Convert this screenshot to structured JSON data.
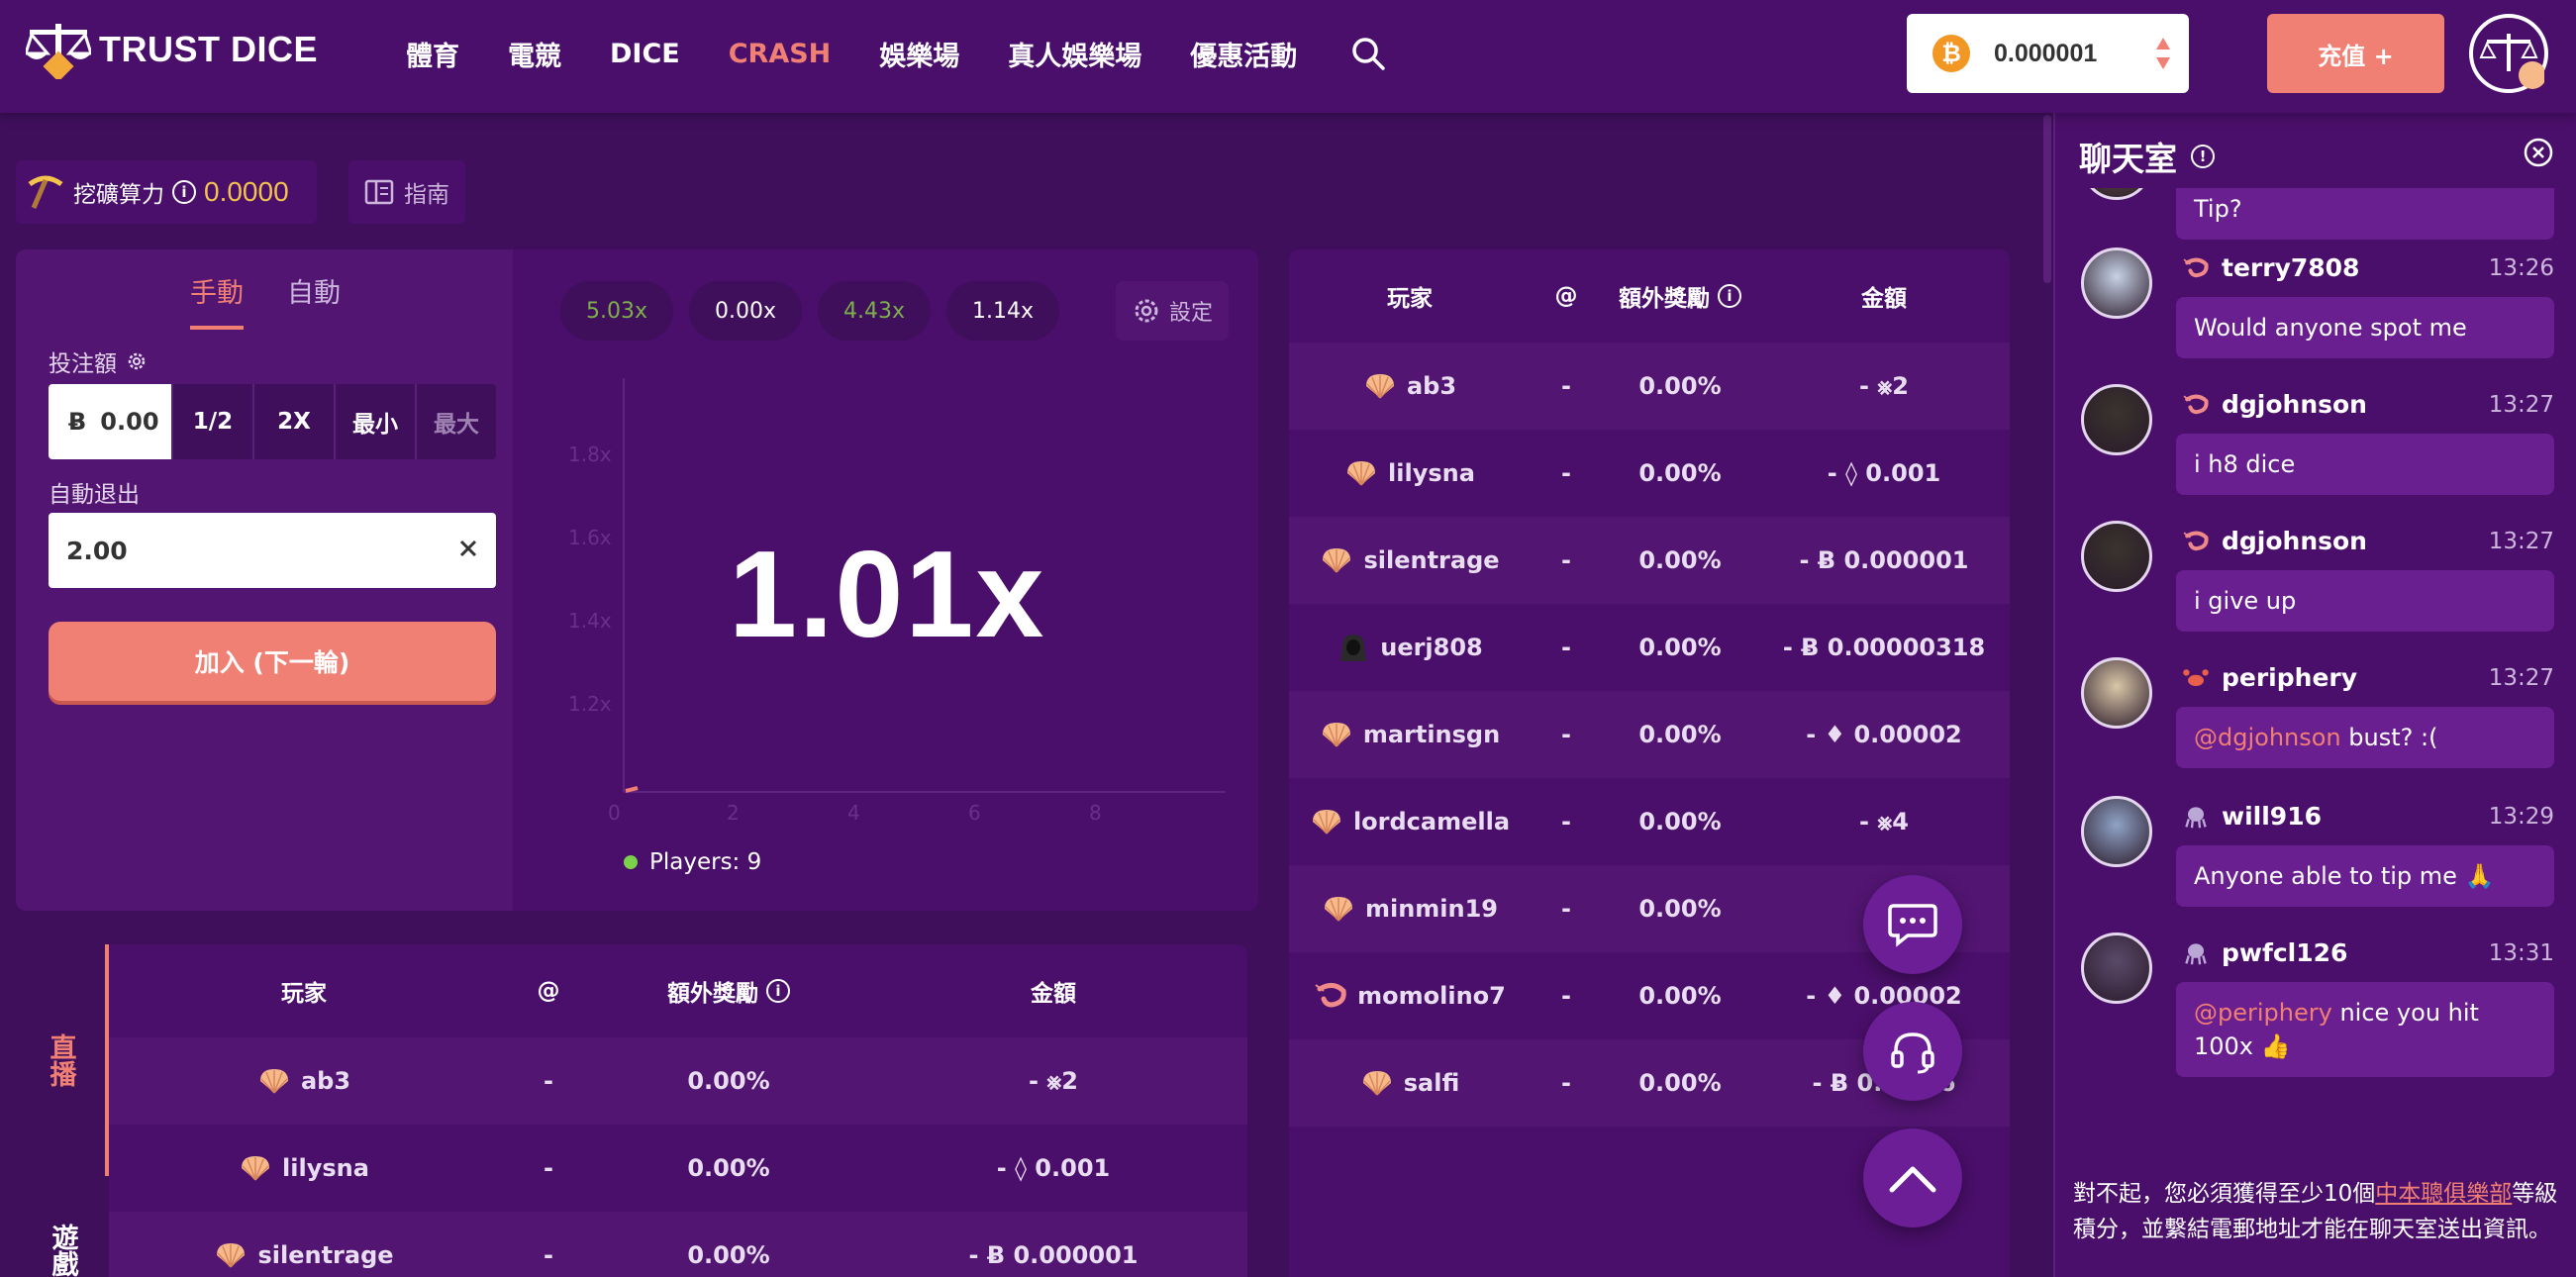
{
  "header": {
    "logo_text": "TRUST DICE",
    "nav": [
      "體育",
      "電競",
      "DICE",
      "CRASH",
      "娛樂場",
      "真人娛樂場",
      "優惠活動"
    ],
    "active_nav": "CRASH",
    "balance": "0.000001",
    "currency_icon": "bitcoin-icon",
    "deposit_label": "充值 +"
  },
  "topbar": {
    "mining_label": "挖礦算力",
    "mining_value": "0.0000",
    "guide_label": "指南"
  },
  "bet": {
    "tabs": [
      "手動",
      "自動"
    ],
    "bet_label": "投注額",
    "amount": "0.00",
    "amount_buttons": [
      "1/2",
      "2X",
      "最小",
      "最大"
    ],
    "autoexit_label": "自動退出",
    "autoexit_value": "2.00",
    "join_label": "加入 (下一輪)"
  },
  "graph": {
    "history": [
      "5.03x",
      "0.00x",
      "4.43x",
      "1.14x"
    ],
    "history_colors": [
      "#7bb04a",
      "#ffffff",
      "#7bb04a",
      "#ffffff"
    ],
    "settings_label": "設定",
    "multiplier": "1.01x",
    "y_ticks": [
      "1.8x",
      "1.6x",
      "1.4x",
      "1.2x"
    ],
    "x_ticks": [
      "0",
      "2",
      "4",
      "6",
      "8"
    ],
    "players_label": "Players: 9"
  },
  "table": {
    "headers": [
      "玩家",
      "@",
      "額外獎勵",
      "金額"
    ],
    "rows": [
      {
        "player": "ab3",
        "icon": "shell-icon",
        "at": "-",
        "bonus": "0.00%",
        "amount": "- ⨳2"
      },
      {
        "player": "lilysna",
        "icon": "shell-icon",
        "at": "-",
        "bonus": "0.00%",
        "amount": "- ◊ 0.001"
      },
      {
        "player": "silentrage",
        "icon": "shell-icon",
        "at": "-",
        "bonus": "0.00%",
        "amount": "- Ƀ 0.000001"
      },
      {
        "player": "uerj808",
        "icon": "hacker-icon",
        "at": "-",
        "bonus": "0.00%",
        "amount": "- Ƀ 0.00000318"
      },
      {
        "player": "martinsgn",
        "icon": "shell-icon",
        "at": "-",
        "bonus": "0.00%",
        "amount": "- ♦ 0.00002"
      },
      {
        "player": "lordcamella",
        "icon": "shell-icon",
        "at": "-",
        "bonus": "0.00%",
        "amount": "- ⨳4"
      },
      {
        "player": "minmin19",
        "icon": "shell-icon",
        "at": "-",
        "bonus": "0.00%",
        "amount": "-◎"
      },
      {
        "player": "momolino7",
        "icon": "shrimp-icon",
        "at": "-",
        "bonus": "0.00%",
        "amount": "- ♦ 0.00002"
      },
      {
        "player": "salfi",
        "icon": "shell-icon",
        "at": "-",
        "bonus": "0.00%",
        "amount": "- Ƀ 0.0…56"
      }
    ]
  },
  "bottom": {
    "side_tabs": [
      "直播",
      "遊戲"
    ],
    "headers": [
      "玩家",
      "@",
      "額外獎勵",
      "金額"
    ],
    "rows": [
      {
        "player": "ab3",
        "at": "-",
        "bonus": "0.00%",
        "amount": "- ⨳2"
      },
      {
        "player": "lilysna",
        "at": "-",
        "bonus": "0.00%",
        "amount": "- ◊ 0.001"
      },
      {
        "player": "silentrage",
        "at": "-",
        "bonus": "0.00%",
        "amount": "- Ƀ 0.000001"
      }
    ]
  },
  "chat": {
    "title": "聊天室",
    "messages": [
      {
        "name": "",
        "time": "",
        "text": "Tip?",
        "rank": ""
      },
      {
        "name": "terry7808",
        "time": "13:26",
        "text": "Would anyone spot me",
        "rank": "shrimp-icon"
      },
      {
        "name": "dgjohnson",
        "time": "13:27",
        "text": "i h8 dice",
        "rank": "shrimp-icon"
      },
      {
        "name": "dgjohnson",
        "time": "13:27",
        "text": "i give up",
        "rank": "shrimp-icon"
      },
      {
        "name": "periphery",
        "time": "13:27",
        "mention": "@dgjohnson",
        "text": " bust? :(",
        "rank": "crab-icon"
      },
      {
        "name": "will916",
        "time": "13:29",
        "text": "Anyone able to tip me 🙏",
        "rank": "octopus-icon"
      },
      {
        "name": "pwfcl126",
        "time": "13:31",
        "mention": "@periphery",
        "text": " nice you hit 100x 👍",
        "rank": "octopus-icon"
      }
    ],
    "notice_pre": "對不起，您必須獲得至少10個",
    "notice_link": "中本聰俱樂部",
    "notice_post": "等級積分，並繫結電郵地址才能在聊天室送出資訊。"
  },
  "colors": {
    "accent": "#f07f74",
    "background": "#3f0f5c",
    "panel": "#4a0f6a",
    "gold": "#f3c34d"
  }
}
